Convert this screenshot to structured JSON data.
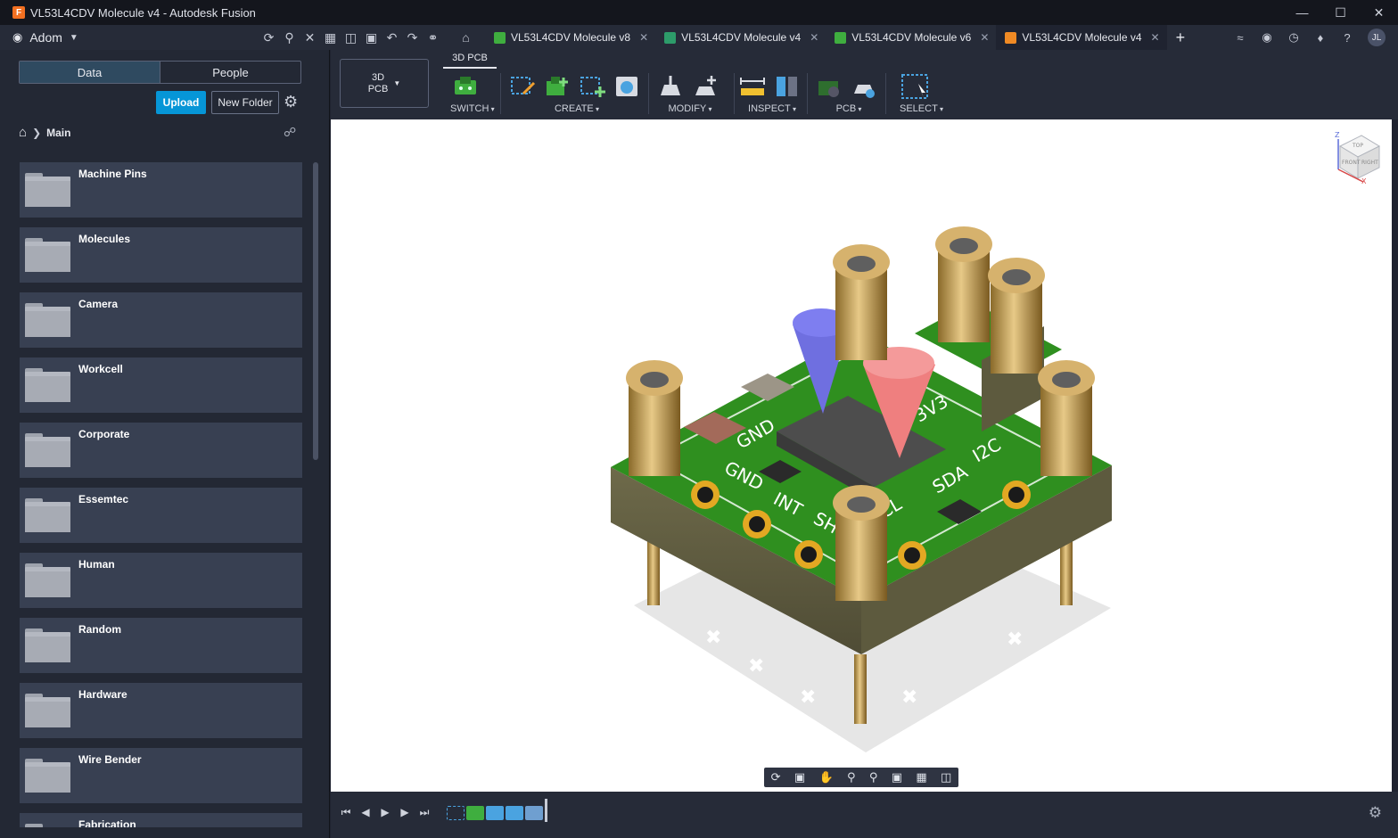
{
  "window": {
    "title": "VL53L4CDV Molecule v4 - Autodesk Fusion",
    "app_icon_letter": "F",
    "controls": [
      "minimize",
      "maximize",
      "close"
    ]
  },
  "team": {
    "name": "Adom"
  },
  "tabs": [
    {
      "label": "VL53L4CDV Molecule v8",
      "kind": "pcb",
      "active": false
    },
    {
      "label": "VL53L4CDV Molecule v4",
      "kind": "schematic",
      "active": false
    },
    {
      "label": "VL53L4CDV Molecule v6",
      "kind": "pcb",
      "active": false
    },
    {
      "label": "VL53L4CDV Molecule v4",
      "kind": "design",
      "active": true
    }
  ],
  "user": {
    "initials": "JL"
  },
  "data_panel": {
    "segments": {
      "data": "Data",
      "people": "People"
    },
    "upload_label": "Upload",
    "new_folder_label": "New Folder",
    "breadcrumb": "Main",
    "folders": [
      "Machine Pins",
      "Molecules",
      "Camera",
      "Workcell",
      "Corporate",
      "Essemtec",
      "Human",
      "Random",
      "Hardware",
      "Wire Bender",
      "Fabrication"
    ]
  },
  "toolbar": {
    "workspace_line1": "3D",
    "workspace_line2": "PCB",
    "active_tab": "3D PCB",
    "groups": {
      "switch": "SWITCH",
      "create": "CREATE",
      "modify": "MODIFY",
      "inspect": "INSPECT",
      "pcb": "PCB",
      "select": "SELECT"
    }
  },
  "viewcube": {
    "top": "TOP",
    "front": "FRONT",
    "right": "RIGHT",
    "axis_z": "Z",
    "axis_x": "X"
  },
  "silkscreen": {
    "gnd_a": "GND",
    "gnd_b": "GND",
    "int": "INT",
    "sho": "SHO",
    "scl": "CL",
    "sda": "SDA",
    "pwr": "3V3",
    "bus": "I2C"
  },
  "colors": {
    "accent": "#0696d7",
    "pcb_green": "#2f8f1f",
    "brass": "#c9a35a",
    "cone_blue": "#6f6fe0",
    "cone_red": "#ef7f7f"
  }
}
